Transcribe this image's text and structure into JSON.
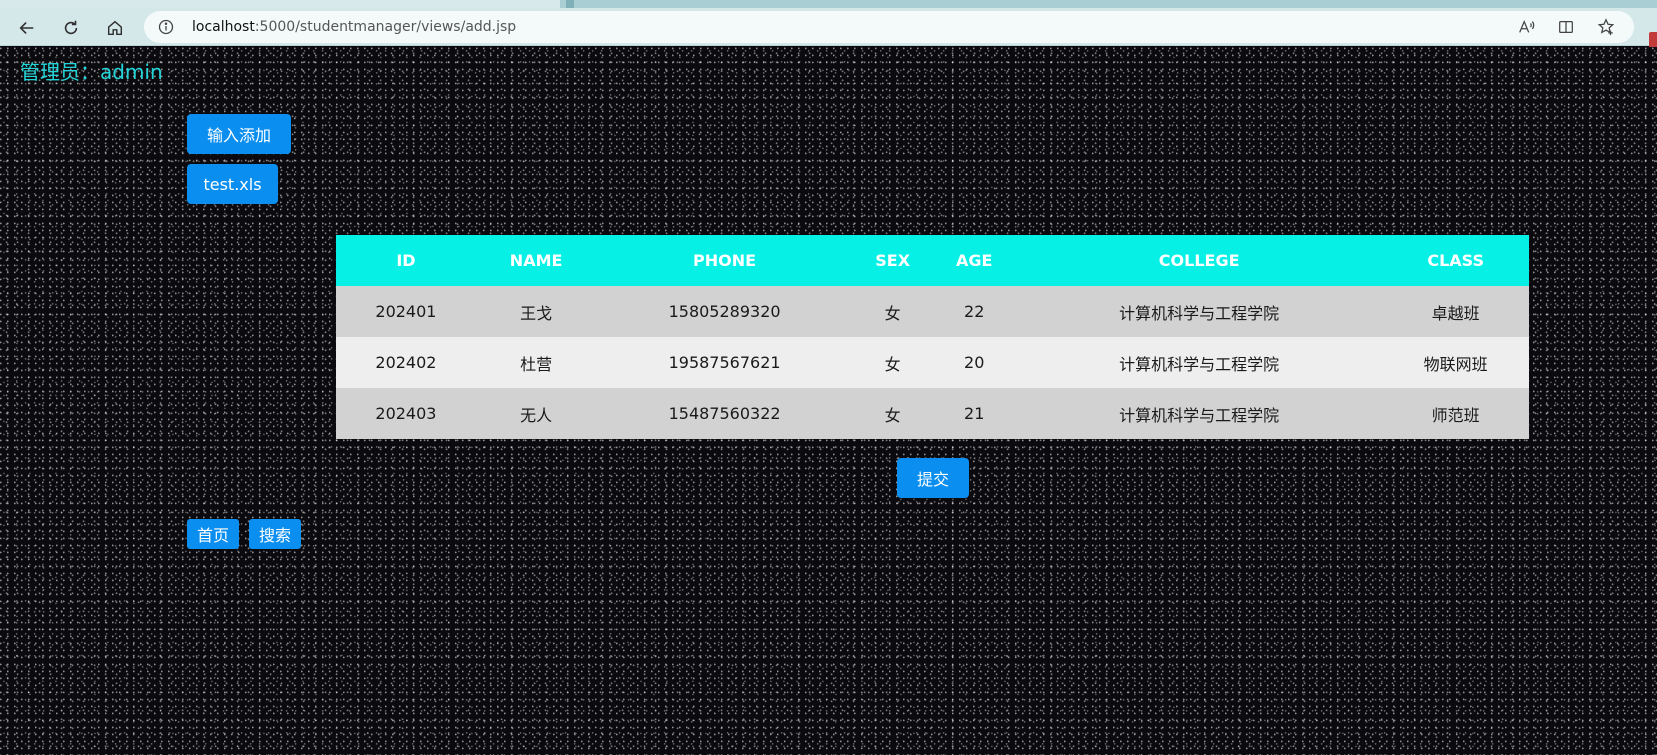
{
  "browser": {
    "url_host": "localhost",
    "url_rest": ":5000/studentmanager/views/add.jsp"
  },
  "header": {
    "admin_label": "管理员：admin"
  },
  "actions": {
    "input_add_label": "输入添加",
    "file_label": "test.xls",
    "submit_label": "提交",
    "home_label": "首页",
    "search_label": "搜索"
  },
  "table": {
    "columns": [
      "ID",
      "NAME",
      "PHONE",
      "SEX",
      "AGE",
      "COLLEGE",
      "CLASS"
    ],
    "rows": [
      [
        "202401",
        "王戈",
        "15805289320",
        "女",
        "22",
        "计算机科学与工程学院",
        "卓越班"
      ],
      [
        "202402",
        "杜营",
        "19587567621",
        "女",
        "20",
        "计算机科学与工程学院",
        "物联网班"
      ],
      [
        "202403",
        "无人",
        "15487560322",
        "女",
        "21",
        "计算机科学与工程学院",
        "师范班"
      ]
    ]
  },
  "colors": {
    "accent_button": "#0a8ff0",
    "table_header": "#06f0e6",
    "admin_text": "#23d4d8",
    "background": "#0b0a0e"
  }
}
